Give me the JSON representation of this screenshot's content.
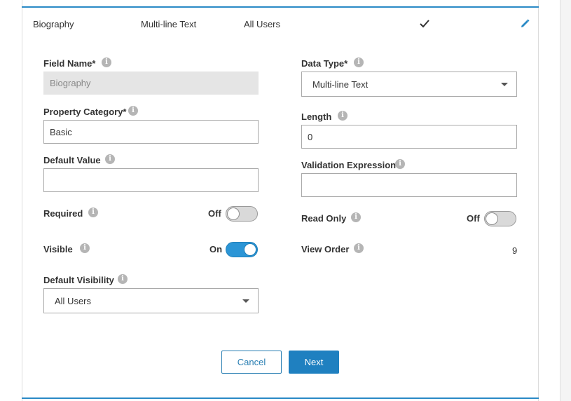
{
  "summary": {
    "field_name": "Biography",
    "data_type": "Multi-line Text",
    "visibility": "All Users"
  },
  "icons": {
    "check": "check-icon",
    "edit": "pencil-icon",
    "info": "info-icon",
    "dropdown": "chevron-down-icon"
  },
  "colors": {
    "accent": "#2a8ac6",
    "toggle_on": "#2b95d6",
    "primary_button": "#1f80c0"
  },
  "form": {
    "field_name": {
      "label": "Field Name*",
      "value": "Biography"
    },
    "data_type": {
      "label": "Data Type*",
      "value": "Multi-line Text"
    },
    "property_category": {
      "label": "Property Category*",
      "value": "Basic"
    },
    "length": {
      "label": "Length",
      "value": "0"
    },
    "default_value": {
      "label": "Default Value",
      "value": ""
    },
    "validation_expression": {
      "label": "Validation Expression",
      "value": ""
    },
    "required": {
      "label": "Required",
      "state": "Off"
    },
    "read_only": {
      "label": "Read Only",
      "state": "Off"
    },
    "visible": {
      "label": "Visible",
      "state": "On"
    },
    "view_order": {
      "label": "View Order",
      "value": "9"
    },
    "default_visibility": {
      "label": "Default Visibility",
      "value": "All Users"
    }
  },
  "buttons": {
    "cancel": "Cancel",
    "next": "Next"
  },
  "info_glyph": "i"
}
